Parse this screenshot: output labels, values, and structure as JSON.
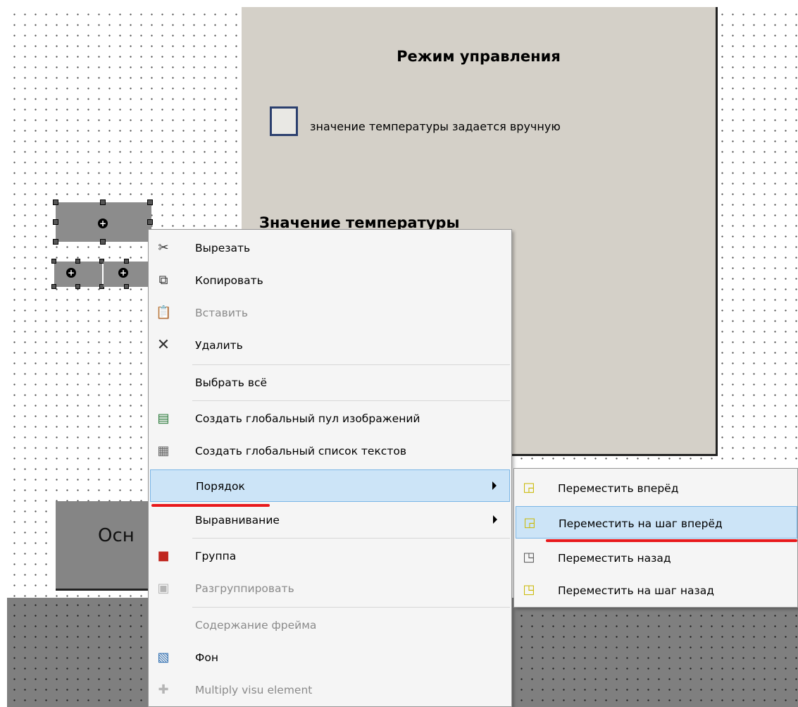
{
  "frame": {
    "title": "Режим управления",
    "checkbox_label": "значение температуры задается вручную",
    "checkbox_checked": false,
    "temperature_title": "Значение температуры"
  },
  "button": {
    "label": "Осн"
  },
  "context_menu": {
    "items": [
      {
        "label": "Вырезать",
        "icon": "scissors-icon",
        "enabled": true
      },
      {
        "label": "Копировать",
        "icon": "copy-icon",
        "enabled": true
      },
      {
        "label": "Вставить",
        "icon": "paste-icon",
        "enabled": false
      },
      {
        "label": "Удалить",
        "icon": "delete-icon",
        "enabled": true
      },
      {
        "label": "Выбрать всё",
        "icon": "",
        "enabled": true
      },
      {
        "label": "Создать глобальный пул изображений",
        "icon": "image-pool-icon",
        "enabled": true
      },
      {
        "label": "Создать глобальный список текстов",
        "icon": "text-list-icon",
        "enabled": true
      },
      {
        "label": "Порядок",
        "icon": "",
        "enabled": true,
        "submenu": true,
        "highlighted": true
      },
      {
        "label": "Выравнивание",
        "icon": "",
        "enabled": true,
        "submenu": true
      },
      {
        "label": "Группа",
        "icon": "group-icon",
        "enabled": true
      },
      {
        "label": "Разгруппировать",
        "icon": "ungroup-icon",
        "enabled": false
      },
      {
        "label": "Содержание фрейма",
        "icon": "",
        "enabled": false
      },
      {
        "label": "Фон",
        "icon": "background-icon",
        "enabled": true
      },
      {
        "label": "Multiply visu element",
        "icon": "multiply-icon",
        "enabled": false
      }
    ]
  },
  "order_submenu": {
    "items": [
      {
        "label": "Переместить вперёд",
        "icon": "bring-to-front-icon"
      },
      {
        "label": "Переместить на шаг вперёд",
        "icon": "bring-forward-icon",
        "highlighted": true
      },
      {
        "label": "Переместить назад",
        "icon": "send-to-back-icon"
      },
      {
        "label": "Переместить на шаг назад",
        "icon": "send-backward-icon"
      }
    ]
  },
  "colors": {
    "frame_bg": "#d4d0c8",
    "highlight_bg": "#cce4f7",
    "highlight_border": "#7ab5e6",
    "annotation_red": "#e8191c",
    "disabled_text": "#8a8a8a"
  }
}
